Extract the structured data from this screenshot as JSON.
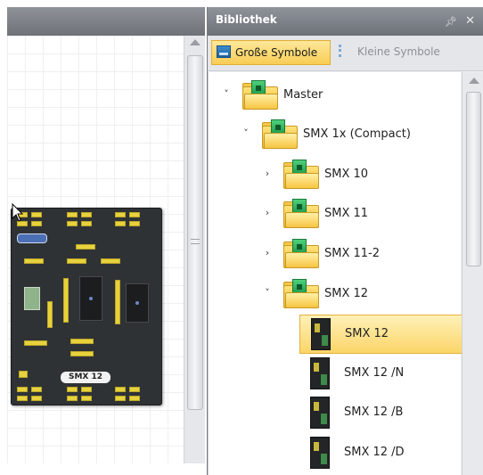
{
  "panel": {
    "title": "Bibliothek",
    "pin_icon": "pin-icon",
    "close_icon": "close-icon"
  },
  "toolbar": {
    "large_icons_label": "Große Symbole",
    "small_icons_label": "Kleine Symbole"
  },
  "device": {
    "label": "SMX 12"
  },
  "tree": {
    "nodes": [
      {
        "label": "Master",
        "expanded": true,
        "icon": "folder-chip-icon"
      },
      {
        "label": "SMX 1x (Compact)",
        "expanded": true,
        "icon": "folder-chip-icon"
      },
      {
        "label": "SMX 10",
        "expanded": false,
        "icon": "folder-chip-icon"
      },
      {
        "label": "SMX 11",
        "expanded": false,
        "icon": "folder-chip-icon"
      },
      {
        "label": "SMX 11-2",
        "expanded": false,
        "icon": "folder-chip-icon"
      },
      {
        "label": "SMX 12",
        "expanded": true,
        "icon": "folder-chip-icon"
      }
    ],
    "items": [
      {
        "label": "SMX 12",
        "selected": true,
        "icon": "device-board-icon"
      },
      {
        "label": "SMX 12 /N",
        "selected": false,
        "icon": "device-board-icon"
      },
      {
        "label": "SMX 12 /B",
        "selected": false,
        "icon": "device-board-icon"
      },
      {
        "label": "SMX 12 /D",
        "selected": false,
        "icon": "device-board-icon"
      }
    ]
  },
  "colors": {
    "title_bar": "#7d8188",
    "selection": "#fbd567",
    "active_button": "#f8cd55"
  }
}
